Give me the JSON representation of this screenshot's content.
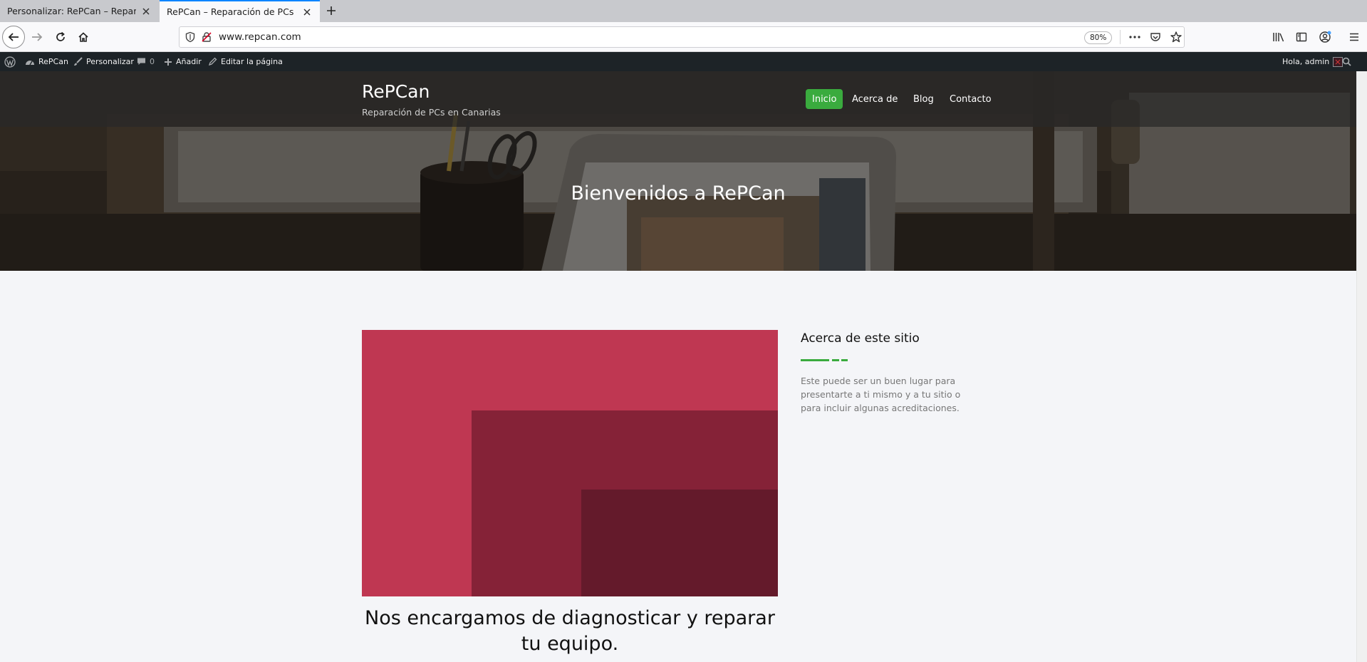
{
  "browser": {
    "tabs": [
      {
        "title": "Personalizar: RePCan – Reparación",
        "active": false
      },
      {
        "title": "RePCan – Reparación de PCs en Canarias",
        "active": true
      }
    ],
    "url": "www.repcan.com",
    "zoom": "80%"
  },
  "admin_bar": {
    "site_name": "RePCan",
    "customize": "Personalizar",
    "comments_count": "0",
    "add_new": "Añadir",
    "edit_page": "Editar la página",
    "greeting": "Hola, admin"
  },
  "site": {
    "title": "RePCan",
    "tagline": "Reparación de PCs en Canarias",
    "menu": [
      "Inicio",
      "Acerca de",
      "Blog",
      "Contacto"
    ],
    "active_menu": "Inicio",
    "hero_title": "Bienvenidos a RePCan"
  },
  "main": {
    "post_title": "Nos encargamos de diagnosticar y reparar tu equipo."
  },
  "sidebar": {
    "widget_title": "Acerca de este sitio",
    "widget_text": "Este puede ser un buen lugar para presentarte a ti mismo y a tu sitio o para incluir algunas acreditaciones."
  },
  "colors": {
    "accent_green": "#3aab3e",
    "featured_light": "#bf3752",
    "featured_mid": "#852237",
    "featured_dark": "#641a2b",
    "admin_bar": "#1d2327"
  }
}
